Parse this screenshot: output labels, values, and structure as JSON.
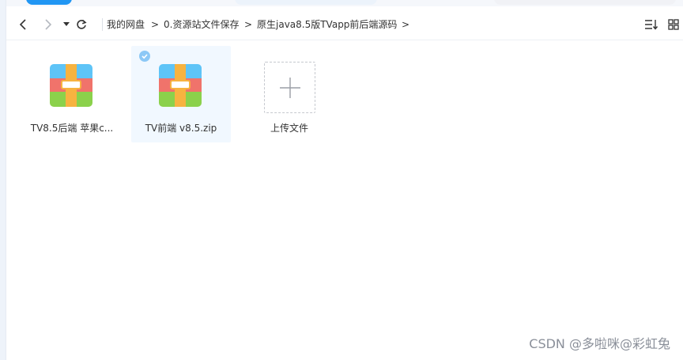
{
  "breadcrumb": {
    "items": [
      "我的网盘",
      "0.资源站文件保存",
      "原生java8.5版TVapp前后端源码"
    ],
    "separator": ">"
  },
  "files": [
    {
      "name": "TV8.5后端 苹果c...",
      "selected": false,
      "type": "zip-archive-icon"
    },
    {
      "name": "TV前端 v8.5.zip",
      "selected": true,
      "type": "zip-archive-icon"
    }
  ],
  "upload": {
    "label": "上传文件"
  },
  "watermark": "CSDN @多啦咪@彩虹兔",
  "colors": {
    "accent": "#2196f3",
    "selected_bg": "#f1f8ff",
    "check": "#8cc8f6",
    "zip_blue": "#5ec4f7",
    "zip_red": "#f0736b",
    "zip_green": "#8bd14b",
    "zip_strap": "#f7b340"
  }
}
